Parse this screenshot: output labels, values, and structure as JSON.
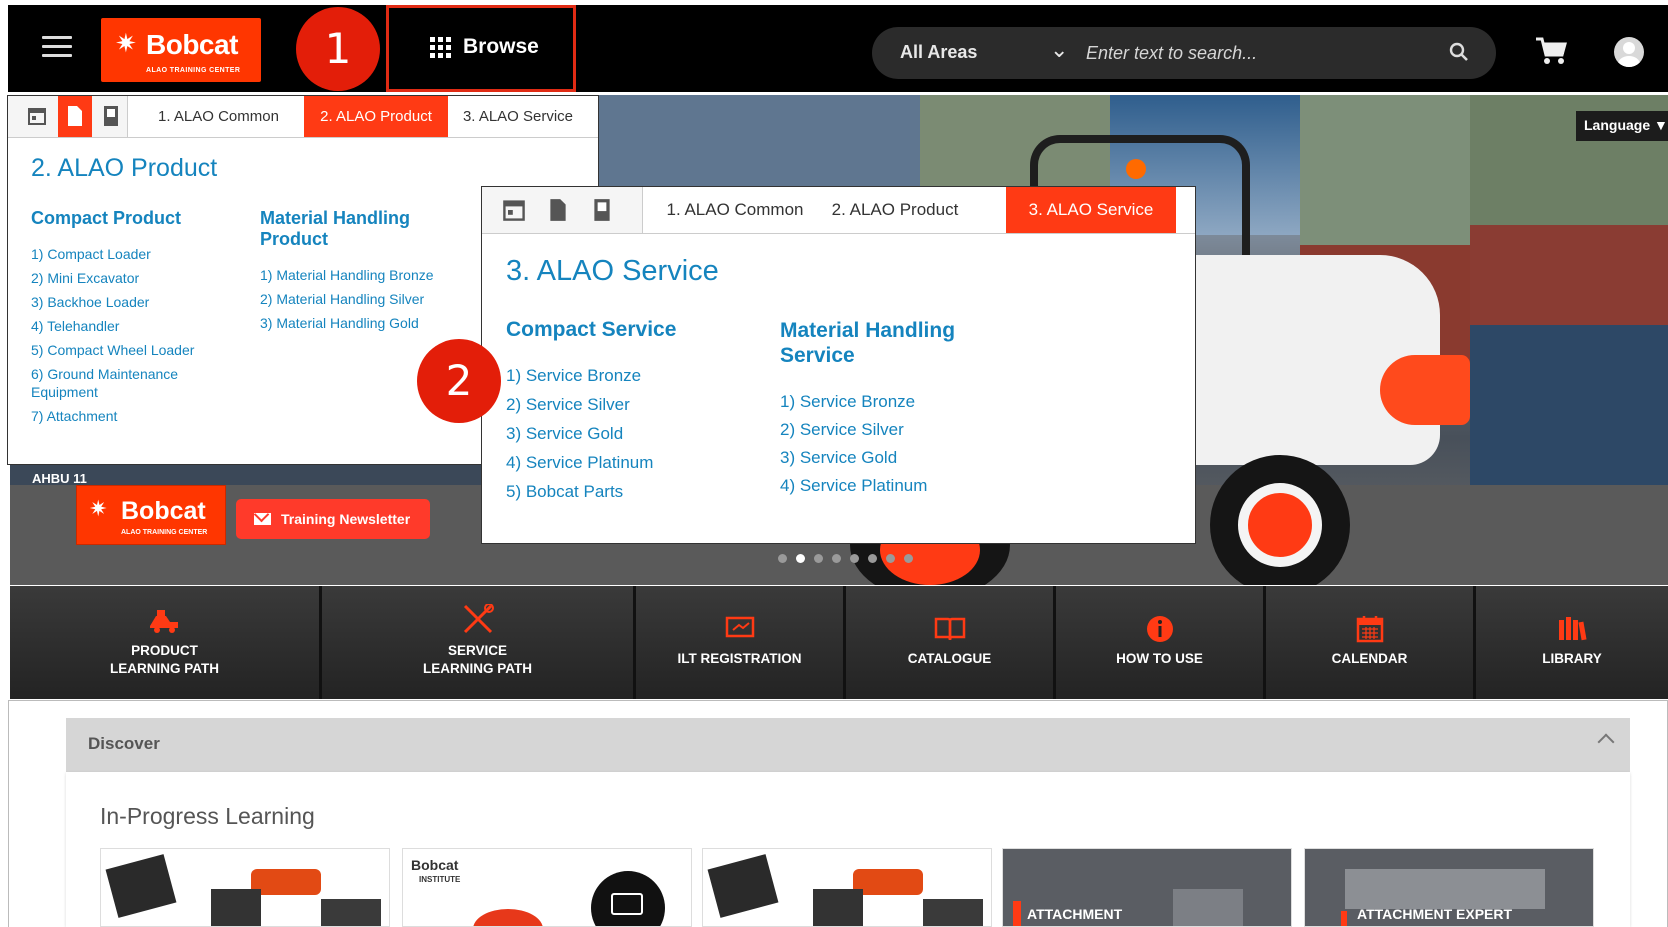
{
  "colors": {
    "accent": "#ff3a14",
    "link": "#1584be",
    "header_bg": "#000000",
    "badge": "#e31e09"
  },
  "header": {
    "logo_word": "Bobcat",
    "logo_sub": "ALAO TRAINING CENTER",
    "browse_label": "Browse",
    "area_select": "All Areas",
    "search_placeholder": "Enter text to search...",
    "icons": [
      "menu-icon",
      "grid-icon",
      "chevron-down-icon",
      "search-icon",
      "cart-icon",
      "user-icon"
    ]
  },
  "annotations": {
    "badge1": "1",
    "badge2": "2"
  },
  "hero": {
    "language_label": "Language ▼",
    "logo_word": "Bobcat",
    "logo_sub": "ALAO TRAINING CENTER",
    "newsletter_label": "Training Newsletter",
    "container_code": "AHBU 11",
    "carousel_active_index": 2,
    "carousel_count": 8
  },
  "menu_product": {
    "tabs": [
      "1. ALAO Common",
      "2. ALAO Product",
      "3. ALAO Service"
    ],
    "active_tab": 1,
    "title": "2. ALAO Product",
    "col1_heading": "Compact Product",
    "col1_items": [
      "1) Compact Loader",
      "2) Mini Excavator",
      "3) Backhoe Loader",
      "4) Telehandler",
      "5) Compact Wheel Loader",
      "6) Ground Maintenance Equipment",
      "7) Attachment"
    ],
    "col2_heading": "Material Handling Product",
    "col2_items": [
      "1) Material Handling Bronze",
      "2) Material Handling Silver",
      "3) Material Handling Gold"
    ]
  },
  "menu_service": {
    "tabs": [
      "1. ALAO Common",
      "2. ALAO Product",
      "3. ALAO Service"
    ],
    "active_tab": 2,
    "title": "3. ALAO Service",
    "col1_heading": "Compact Service",
    "col1_items": [
      "1) Service Bronze",
      "2) Service Silver",
      "3) Service Gold",
      "4) Service Platinum",
      "5) Bobcat Parts"
    ],
    "col2_heading": "Material Handling Service",
    "col2_items": [
      "1) Service Bronze",
      "2) Service Silver",
      "3) Service Gold",
      "4) Service Platinum"
    ]
  },
  "tiles": [
    {
      "line1": "PRODUCT",
      "line2": "LEARNING PATH",
      "icon": "loader-icon"
    },
    {
      "line1": "SERVICE",
      "line2": "LEARNING PATH",
      "icon": "tools-icon"
    },
    {
      "line1": "ILT REGISTRATION",
      "line2": "",
      "icon": "presentation-icon"
    },
    {
      "line1": "CATALOGUE",
      "line2": "",
      "icon": "book-icon"
    },
    {
      "line1": "HOW TO USE",
      "line2": "",
      "icon": "info-icon"
    },
    {
      "line1": "CALENDAR",
      "line2": "",
      "icon": "calendar-icon"
    },
    {
      "line1": "LIBRARY",
      "line2": "",
      "icon": "library-icon"
    }
  ],
  "discover": {
    "title": "Discover",
    "section": "In-Progress Learning",
    "cards": [
      {
        "caption": ""
      },
      {
        "caption": ""
      },
      {
        "caption": ""
      },
      {
        "caption": "ATTACHMENT"
      },
      {
        "caption": "ATTACHMENT EXPERT"
      }
    ],
    "card2_logo": "Bobcat",
    "card2_sub": "INSTITUTE"
  }
}
